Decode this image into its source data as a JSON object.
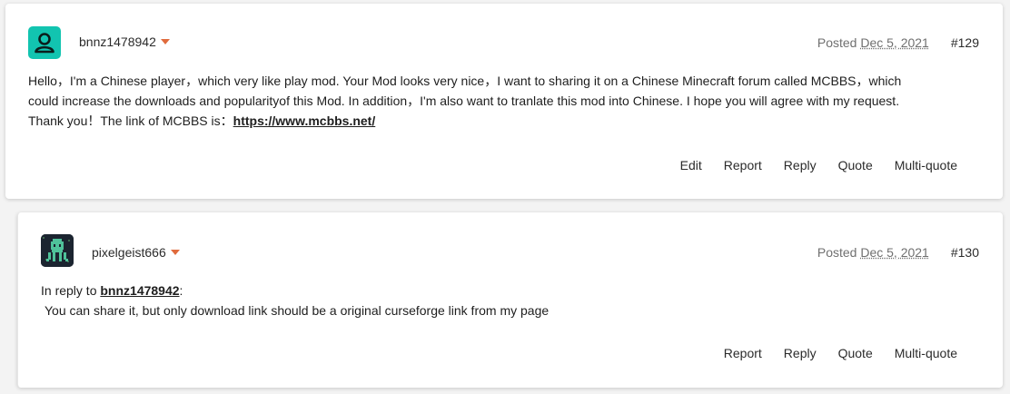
{
  "posts": [
    {
      "username": "bnnz1478942",
      "posted_label": "Posted",
      "date": "Dec 5, 2021",
      "number": "#129",
      "body_lines": [
        "Hello，I'm a Chinese player，which very like play mod. Your Mod looks very nice，I want to sharing it on a Chinese Minecraft forum called MCBBS，which",
        "could increase the downloads and popularityof this Mod. In addition，I'm also want to tranlate this mod into Chinese. I hope you will agree with my request."
      ],
      "body_last_prefix": "Thank you！The link of MCBBS is：",
      "link_text": "https://www.mcbbs.net/",
      "actions": {
        "edit": "Edit",
        "report": "Report",
        "reply": "Reply",
        "quote": "Quote",
        "multiquote": "Multi-quote"
      }
    },
    {
      "username": "pixelgeist666",
      "posted_label": "Posted",
      "date": "Dec 5, 2021",
      "number": "#130",
      "reply_prefix": "In reply to",
      "reply_user": "bnnz1478942",
      "reply_suffix": ":",
      "body_line": "You can share it, but only download link should be a original curseforge link from my page",
      "actions": {
        "report": "Report",
        "reply": "Reply",
        "quote": "Quote",
        "multiquote": "Multi-quote"
      }
    }
  ],
  "colors": {
    "accent": "#e06b3d",
    "avatar1": "#12c4b0",
    "avatar2": "#1b2430"
  }
}
